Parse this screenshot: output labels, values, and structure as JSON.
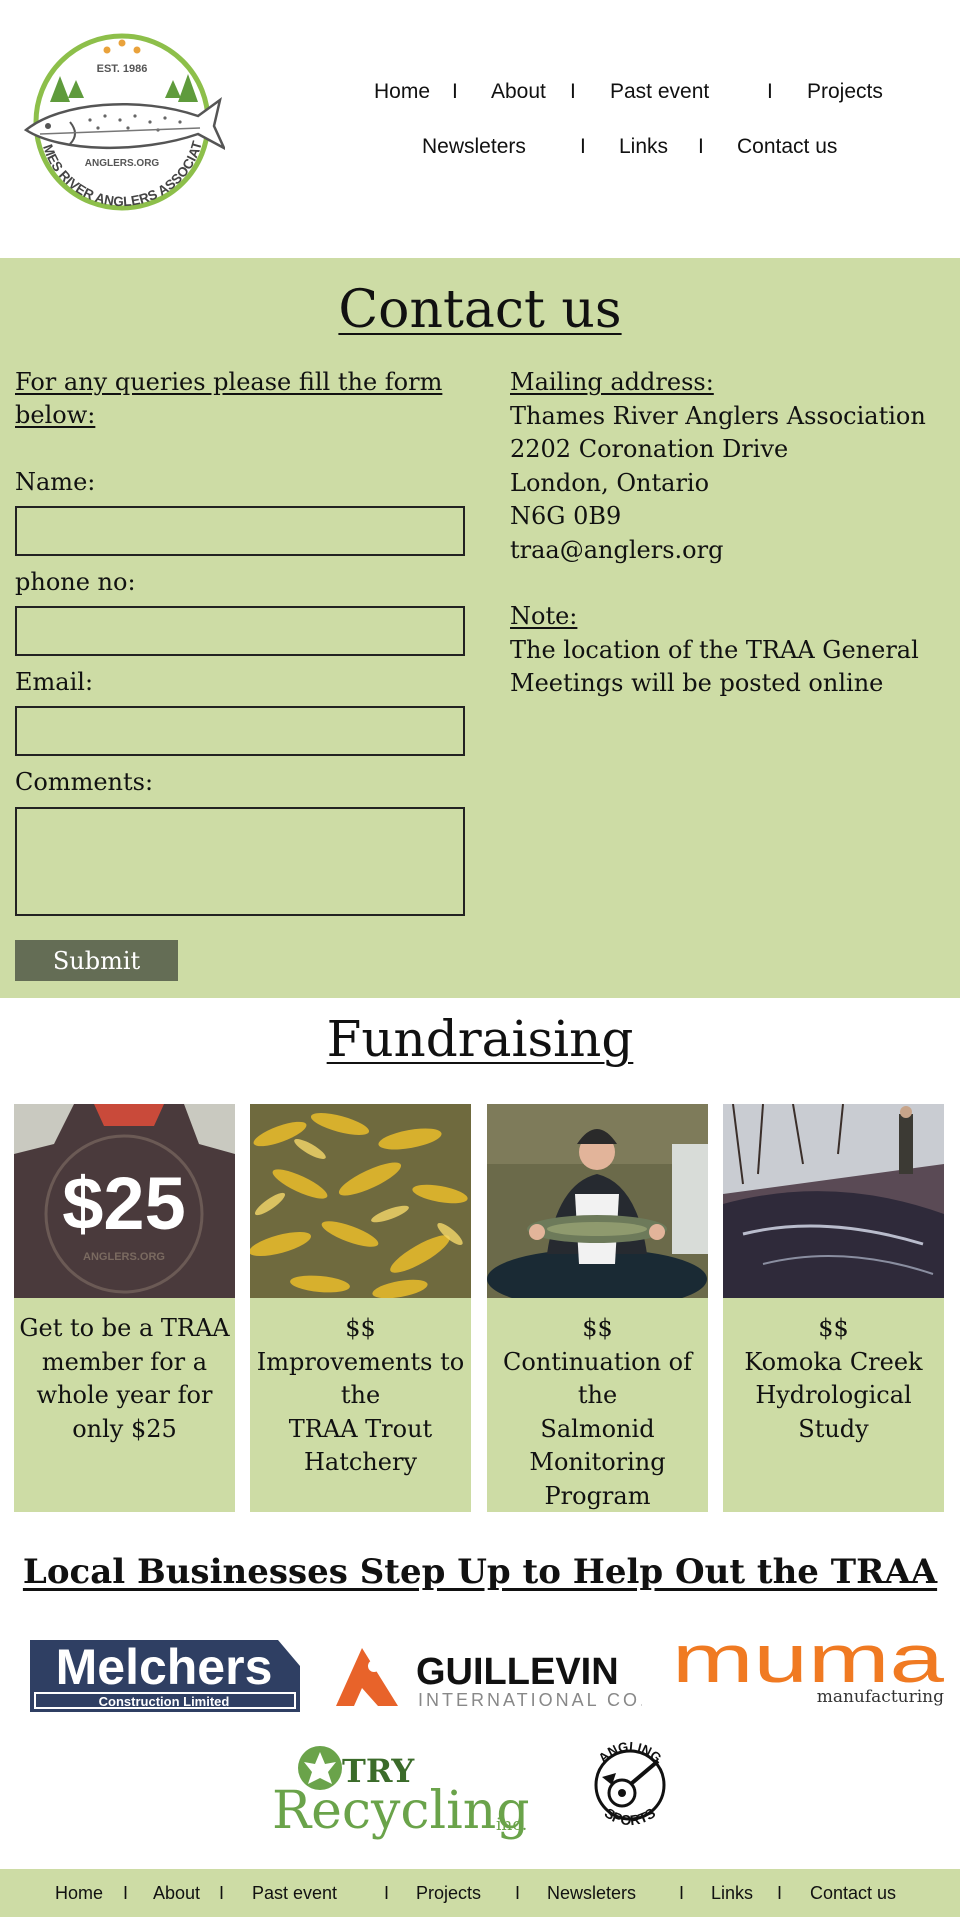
{
  "logo": {
    "est": "EST. 1986",
    "site": "ANGLERS.ORG",
    "name": "THAMES RIVER ANGLERS ASSOCIATION"
  },
  "nav": {
    "items": [
      "Home",
      "About",
      "Past event",
      "Projects",
      "Newsleters",
      "Links",
      "Contact us"
    ],
    "separator": "I"
  },
  "contact": {
    "title": "Contact us",
    "intro": "For any queries please fill the form below:",
    "fields": {
      "name_label": "Name:",
      "phone_label": "phone no:",
      "email_label": "Email:",
      "comments_label": "Comments:",
      "name_value": "",
      "phone_value": "",
      "email_value": "",
      "comments_value": ""
    },
    "submit_label": "Submit",
    "mailing": {
      "heading": "Mailing address:",
      "lines": [
        "Thames River Anglers Association",
        "2202 Coronation Drive",
        "London, Ontario",
        "N6G 0B9",
        "traa@anglers.org"
      ]
    },
    "note": {
      "heading": "Note:",
      "text": "The location of the TRAA General Meetings will be posted online"
    }
  },
  "fundraising": {
    "title": "Fundraising",
    "cards": [
      {
        "image_text": "$25",
        "lines": [
          "Get to be a TRAA",
          "member for a",
          "whole year for",
          "only $25"
        ]
      },
      {
        "lines": [
          "$$",
          "Improvements to",
          "the",
          "TRAA Trout",
          "Hatchery"
        ]
      },
      {
        "lines": [
          "$$",
          "Continuation of",
          "the",
          "Salmonid",
          "Monitoring",
          "Program"
        ]
      },
      {
        "lines": [
          "$$",
          "Komoka Creek",
          "Hydrological",
          "Study"
        ]
      }
    ]
  },
  "sponsors": {
    "title": "Local Businesses Step Up to Help Out the TRAA",
    "melchers": {
      "name": "Melchers",
      "sub": "Construction Limited"
    },
    "guillevin": {
      "name": "GUILLEVIN",
      "sub": "INTERNATIONAL CO."
    },
    "muma": {
      "name": "muma",
      "sub": "manufacturing"
    },
    "try": {
      "top": "TRY",
      "main": "Recycling",
      "suffix": "inc."
    },
    "angling": {
      "top": "ANGLING",
      "bottom": "SPORTS"
    }
  },
  "colors": {
    "section_bg": "#cddca5",
    "submit_bg": "#646d55",
    "logo_green": "#7db142",
    "melchers_navy": "#2f3f63",
    "guillevin_orange": "#e8632a",
    "muma_orange": "#f07a22",
    "try_green": "#6aa34a"
  }
}
